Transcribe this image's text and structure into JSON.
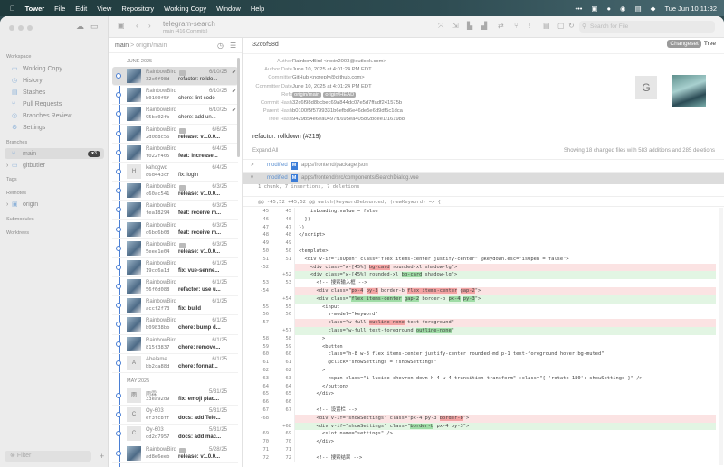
{
  "menubar": {
    "app": "Tower",
    "items": [
      "File",
      "Edit",
      "View",
      "Repository",
      "Working Copy",
      "Window",
      "Help"
    ],
    "clock": "Tue Jun 10  11:32",
    "status_icons": [
      "more-icon",
      "calendar-icon",
      "wechat-icon",
      "shield-icon",
      "battery-icon",
      "siri-icon"
    ]
  },
  "toolbar": {
    "repo": "telegram-search",
    "branch_info": "main (416 Commits)",
    "search_placeholder": "Search for File",
    "icons": [
      "cloud-icon",
      "drive-icon",
      "folder-icon",
      "back-icon",
      "forward-icon",
      "merge-icon",
      "fetch-icon",
      "pull-icon",
      "push-icon",
      "sync-icon",
      "branch-icon",
      "tag-icon",
      "stash-icon",
      "unstash-icon",
      "sort-icon",
      "refresh-icon"
    ]
  },
  "sidebar": {
    "workspace_label": "Workspace",
    "workspace": [
      {
        "label": "Working Copy",
        "icon": "folder-icon"
      },
      {
        "label": "History",
        "icon": "clock-icon"
      },
      {
        "label": "Stashes",
        "icon": "box-icon"
      },
      {
        "label": "Pull Requests",
        "icon": "pull-request-icon"
      },
      {
        "label": "Branches Review",
        "icon": "review-icon"
      },
      {
        "label": "Settings",
        "icon": "gear-icon"
      }
    ],
    "branches_label": "Branches",
    "branches": [
      {
        "label": "main",
        "badge": "▾3",
        "selected": true
      },
      {
        "label": "gitbutler"
      }
    ],
    "tags_label": "Tags",
    "remotes_label": "Remotes",
    "remotes": [
      {
        "label": "origin"
      }
    ],
    "submodules_label": "Submodules",
    "worktrees_label": "Worktrees",
    "filter_placeholder": "Filter"
  },
  "list": {
    "branch": "main",
    "upstream": " > origin/main",
    "groups": [
      {
        "month": "JUNE 2025",
        "commits": [
          {
            "author": "RainbowBird",
            "tag": true,
            "date": "6/10/25",
            "hash": "32c6f98d",
            "msg": "refactor: rolldo...",
            "bold": false,
            "pin": true,
            "avatar": "photo",
            "selected": true
          },
          {
            "author": "RainbowBird",
            "date": "6/10/25",
            "hash": "b0100f5f",
            "msg": "chore: lint code",
            "pin": true,
            "avatar": "photo"
          },
          {
            "author": "RainbowBird",
            "date": "6/10/25",
            "hash": "95bc02fb",
            "msg": "chore: add un...",
            "pin": true,
            "avatar": "photo"
          },
          {
            "author": "RainbowBird",
            "tag": true,
            "date": "6/6/25",
            "hash": "2d088c56",
            "msg": "release: v1.0.0...",
            "bold": true,
            "avatar": "photo"
          },
          {
            "author": "RainbowBird",
            "date": "6/4/25",
            "hash": "f022f405",
            "msg": "feat: increase...",
            "bold": true,
            "avatar": "photo"
          },
          {
            "author": "kahogwq",
            "date": "6/4/25",
            "hash": "86d443cf",
            "msg": "fix: login",
            "avatar": "H"
          },
          {
            "author": "RainbowBird",
            "tag": true,
            "date": "6/3/25",
            "hash": "c60ac541",
            "msg": "release: v1.0.0...",
            "bold": true,
            "avatar": "photo"
          },
          {
            "author": "RainbowBird",
            "date": "6/3/25",
            "hash": "fea18294",
            "msg": "feat: receive m...",
            "bold": true,
            "avatar": "photo"
          },
          {
            "author": "RainbowBird",
            "date": "6/3/25",
            "hash": "d6bd6b08",
            "msg": "feat: receive m...",
            "bold": true,
            "avatar": "photo"
          },
          {
            "author": "RainbowBird",
            "tag": true,
            "date": "6/3/25",
            "hash": "5eee1e04",
            "msg": "release: v1.0.0...",
            "bold": true,
            "avatar": "photo"
          },
          {
            "author": "RainbowBird",
            "date": "6/1/25",
            "hash": "19cd6a1d",
            "msg": "fix: vue-senne...",
            "bold": true,
            "avatar": "photo"
          },
          {
            "author": "RainbowBird",
            "date": "6/1/25",
            "hash": "56f6d088",
            "msg": "refactor: use u...",
            "bold": true,
            "avatar": "photo"
          },
          {
            "author": "RainbowBird",
            "date": "6/1/25",
            "hash": "accf2f73",
            "msg": "fix: build",
            "bold": true,
            "avatar": "photo"
          },
          {
            "author": "RainbowBird",
            "date": "6/1/25",
            "hash": "b09838bb",
            "msg": "chore: bump d...",
            "bold": true,
            "avatar": "photo"
          },
          {
            "author": "RainbowBird",
            "date": "6/1/25",
            "hash": "815f3837",
            "msg": "chore: remove...",
            "bold": true,
            "avatar": "photo"
          },
          {
            "author": "Abelame",
            "date": "6/1/25",
            "hash": "bb2ca88d",
            "msg": "chore: format...",
            "bold": true,
            "avatar": "A"
          }
        ]
      },
      {
        "month": "MAY 2025",
        "commits": [
          {
            "author": "雨霖",
            "date": "5/31/25",
            "hash": "33ea92d9",
            "msg": "fix: emoji plac...",
            "bold": true,
            "avatar": "雨"
          },
          {
            "author": "Oy-603",
            "date": "5/31/25",
            "hash": "ef3fc8ff",
            "msg": "docs: add Tele...",
            "bold": true,
            "avatar": "C"
          },
          {
            "author": "Oy-603",
            "date": "5/31/25",
            "hash": "dd2d7957",
            "msg": "docs: add mac...",
            "bold": true,
            "avatar": "C"
          },
          {
            "author": "RainbowBird",
            "tag": true,
            "date": "5/28/25",
            "hash": "ad8e6eeb",
            "msg": "release: v1.0.0...",
            "bold": true,
            "avatar": "photo"
          }
        ]
      }
    ]
  },
  "detail": {
    "hash": "32c6f98d",
    "view_toggle": [
      "Changeset",
      "Tree"
    ],
    "meta": [
      {
        "k": "Author",
        "v": "RainbowBird <rbxin2003@outlook.com>"
      },
      {
        "k": "Author Date",
        "v": "June 10, 2025 at 4:01:24 PM EDT"
      },
      {
        "k": "Committer",
        "v": "GitHub <noreply@github.com>"
      },
      {
        "k": "Committer Date",
        "v": "June 10, 2025 at 4:01:24 PM EDT"
      },
      {
        "k": "Refs",
        "refs": [
          "origin/main",
          "origin/HEAD"
        ]
      },
      {
        "k": "Commit Hash",
        "v": "32c6f98d8bcbec69a844dc07e5d7ffadf241575b"
      },
      {
        "k": "Parent Hash",
        "v": "b0100f5f5799331b6efbd6e46de5e6d9df5c1dca"
      },
      {
        "k": "Tree Hash",
        "v": "9429b54e6ea0497f1695ea4058f2bdee1f161988"
      }
    ],
    "committer_avatar": "G",
    "message": "refactor: rolldown (#219)",
    "expand_all": "Expand All",
    "summary": "Showing 18 changed files with 583 additions and 285 deletions",
    "files": [
      {
        "chev": ">",
        "status": "modified",
        "type": "M",
        "path": "apps/frontend/package.json"
      },
      {
        "chev": "v",
        "status": "modified",
        "type": "M",
        "path": "apps/frontend/src/components/SearchDialog.vue",
        "selected": true
      }
    ],
    "chunk_info": "1 chunk, 7 insertions, 7 deletions",
    "hunk_header": "@@ -45,52 +45,52 @@ watch(keywordDebounced, (newKeyword) => {",
    "lines": [
      {
        "o": "45",
        "n": "45",
        "t": "ctx",
        "s": [
          [
            "    isLoading.value = false"
          ]
        ]
      },
      {
        "o": "46",
        "n": "46",
        "t": "ctx",
        "s": [
          [
            "  })"
          ]
        ]
      },
      {
        "o": "47",
        "n": "47",
        "t": "ctx",
        "s": [
          [
            "})"
          ]
        ]
      },
      {
        "o": "48",
        "n": "48",
        "t": "ctx",
        "s": [
          [
            "</script>"
          ]
        ]
      },
      {
        "o": "49",
        "n": "49",
        "t": "ctx",
        "s": [
          [
            ""
          ]
        ]
      },
      {
        "o": "50",
        "n": "50",
        "t": "ctx",
        "s": [
          [
            "<template>"
          ]
        ]
      },
      {
        "o": "51",
        "n": "51",
        "t": "ctx",
        "s": [
          [
            "  <div v-if=\"isOpen\" class=\"flex items-center justify-center\" @keydown.esc=\"isOpen = false\">"
          ]
        ]
      },
      {
        "o": "-52",
        "n": "",
        "t": "del",
        "s": [
          [
            "    <div class=\"w-[45%] "
          ],
          [
            "bg-card",
            1
          ],
          [
            " rounded-xl shadow-lg\">"
          ]
        ]
      },
      {
        "o": "",
        "n": "+52",
        "t": "add",
        "s": [
          [
            "    <div class=\"w-[45%] rounded-xl "
          ],
          [
            "bg-card",
            1
          ],
          [
            " shadow-lg\">"
          ]
        ]
      },
      {
        "o": "53",
        "n": "53",
        "t": "ctx",
        "s": [
          [
            "      <!-- 搜索输入框 -->"
          ]
        ]
      },
      {
        "o": "-54",
        "n": "",
        "t": "del",
        "s": [
          [
            "      <div class=\""
          ],
          [
            "px-4",
            1
          ],
          [
            " "
          ],
          [
            "py-3",
            1
          ],
          [
            " border-b "
          ],
          [
            "flex items-center",
            1
          ],
          [
            " "
          ],
          [
            "gap-2",
            1
          ],
          [
            "\">"
          ]
        ]
      },
      {
        "o": "",
        "n": "+54",
        "t": "add",
        "s": [
          [
            "      <div class=\""
          ],
          [
            "flex items-center",
            1
          ],
          [
            " "
          ],
          [
            "gap-2",
            1
          ],
          [
            " border-b "
          ],
          [
            "px-4",
            1
          ],
          [
            " "
          ],
          [
            "py-3",
            1
          ],
          [
            "\">"
          ]
        ]
      },
      {
        "o": "55",
        "n": "55",
        "t": "ctx",
        "s": [
          [
            "        <input"
          ]
        ]
      },
      {
        "o": "56",
        "n": "56",
        "t": "ctx",
        "s": [
          [
            "          v-model=\"keyword\""
          ]
        ]
      },
      {
        "o": "-57",
        "n": "",
        "t": "del",
        "s": [
          [
            "          class=\"w-full "
          ],
          [
            "outline-none",
            1
          ],
          [
            " text-foreground\""
          ]
        ]
      },
      {
        "o": "",
        "n": "+57",
        "t": "add",
        "s": [
          [
            "          class=\"w-full text-foreground "
          ],
          [
            "outline-none",
            1
          ],
          [
            "\""
          ]
        ]
      },
      {
        "o": "58",
        "n": "58",
        "t": "ctx",
        "s": [
          [
            "        >"
          ]
        ]
      },
      {
        "o": "59",
        "n": "59",
        "t": "ctx",
        "s": [
          [
            "        <button"
          ]
        ]
      },
      {
        "o": "60",
        "n": "60",
        "t": "ctx",
        "s": [
          [
            "          class=\"h-8 w-8 flex items-center justify-center rounded-md p-1 text-foreground hover:bg-muted\""
          ]
        ]
      },
      {
        "o": "61",
        "n": "61",
        "t": "ctx",
        "s": [
          [
            "          @click=\"showSettings = !showSettings\""
          ]
        ]
      },
      {
        "o": "62",
        "n": "62",
        "t": "ctx",
        "s": [
          [
            "        >"
          ]
        ]
      },
      {
        "o": "63",
        "n": "63",
        "t": "ctx",
        "s": [
          [
            "          <span class=\"i-lucide-chevron-down h-4 w-4 transition-transform\" :class=\"{ 'rotate-180': showSettings }\" />"
          ]
        ]
      },
      {
        "o": "64",
        "n": "64",
        "t": "ctx",
        "s": [
          [
            "        </button>"
          ]
        ]
      },
      {
        "o": "65",
        "n": "65",
        "t": "ctx",
        "s": [
          [
            "      </div>"
          ]
        ]
      },
      {
        "o": "66",
        "n": "66",
        "t": "ctx",
        "s": [
          [
            ""
          ]
        ]
      },
      {
        "o": "67",
        "n": "67",
        "t": "ctx",
        "s": [
          [
            "      <!-- 设置栏 -->"
          ]
        ]
      },
      {
        "o": "-68",
        "n": "",
        "t": "del",
        "s": [
          [
            "      <div v-if=\"showSettings\" class=\"px-4 py-3 "
          ],
          [
            "border-b",
            1
          ],
          [
            "\">"
          ]
        ]
      },
      {
        "o": "",
        "n": "+68",
        "t": "add",
        "s": [
          [
            "      <div v-if=\"showSettings\" class=\""
          ],
          [
            "border-b",
            1
          ],
          [
            " px-4 py-3\">"
          ]
        ]
      },
      {
        "o": "69",
        "n": "69",
        "t": "ctx",
        "s": [
          [
            "        <slot name=\"settings\" />"
          ]
        ]
      },
      {
        "o": "70",
        "n": "70",
        "t": "ctx",
        "s": [
          [
            "      </div>"
          ]
        ]
      },
      {
        "o": "71",
        "n": "71",
        "t": "ctx",
        "s": [
          [
            ""
          ]
        ]
      },
      {
        "o": "72",
        "n": "72",
        "t": "ctx",
        "s": [
          [
            "      <!-- 搜索结果 -->"
          ]
        ]
      }
    ]
  },
  "colors": {
    "accent": "#4a7fd4",
    "deleted": "#fbe3e3",
    "added": "#e2f5e3",
    "modified_badge": "#3b7dd8"
  }
}
